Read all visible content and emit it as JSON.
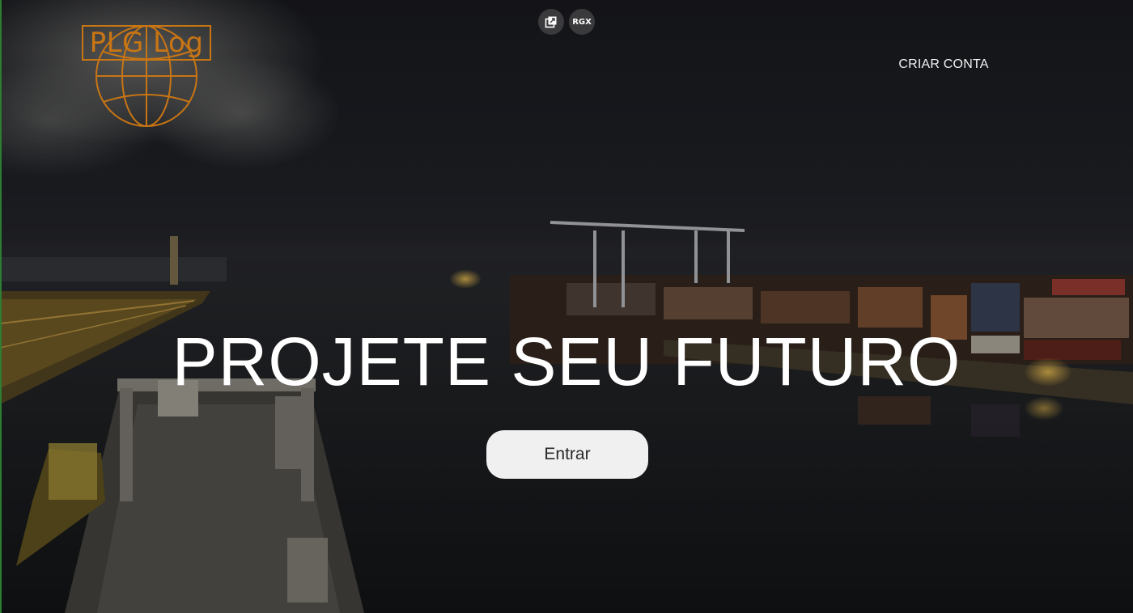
{
  "brand": {
    "logo_text": "PLG Log",
    "accent_color": "#c87514"
  },
  "toolbar": {
    "items": [
      {
        "icon": "external-window-icon",
        "label": ""
      },
      {
        "icon": "rgx-badge",
        "label": "RGX"
      }
    ]
  },
  "nav": {
    "create_account": "CRIAR CONTA"
  },
  "hero": {
    "headline": "PROJETE SEU FUTURO",
    "enter_button": "Entrar",
    "background": "night-port-container-terminal"
  }
}
